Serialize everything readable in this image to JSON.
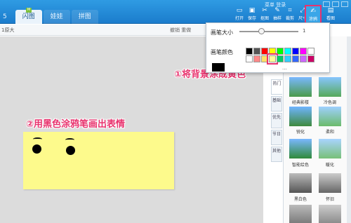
{
  "app": {
    "tabs": [
      {
        "label": "5",
        "active": false
      },
      {
        "label": "闪图",
        "active": true
      },
      {
        "label": "娃娃",
        "active": false
      },
      {
        "label": "拼图",
        "active": false
      }
    ],
    "tab_badge": "M",
    "menu_text": "菜单  登录"
  },
  "toolbar": {
    "items": [
      {
        "label": "打开",
        "icon": "folder-icon"
      },
      {
        "label": "保存",
        "icon": "save-icon"
      },
      {
        "label": "抠图",
        "icon": "scissors-icon"
      },
      {
        "label": "抽样",
        "icon": "eyedropper-icon"
      },
      {
        "label": "裁剪",
        "icon": "crop-icon"
      },
      {
        "label": "尺寸",
        "icon": "resize-icon"
      }
    ],
    "doodle_label": "涂鸦",
    "extra_label": "看图"
  },
  "subbar": {
    "left": "1原大",
    "right": "撤销 重做"
  },
  "doodle_panel": {
    "brush_size_label": "画笔大小",
    "brush_size_value": "1",
    "brush_color_label": "画笔颜色",
    "more_colors": "...",
    "colors": [
      "#000000",
      "#555555",
      "#ff0000",
      "#ffff00",
      "#00ff00",
      "#00ffff",
      "#0000ff",
      "#ff00ff",
      "#ffffff",
      "#ffffff",
      "#ff8888",
      "#ffe066",
      "#ffff99",
      "#00cc66",
      "#33ccff",
      "#3366ff",
      "#cc66ff",
      "#cc0066"
    ],
    "selected_index": 12,
    "accent": "#e8336e"
  },
  "annotations": {
    "step1": "①将背景涂成黄色",
    "step2": "②用黑色涂鸦笔画出表情"
  },
  "sidebar": {
    "vtabs": [
      "热门",
      "基础",
      "优先",
      "节日",
      "其他"
    ],
    "thumb_labels": [
      "经典影楼",
      "冷色调",
      "锐化",
      "柔和",
      "智能绘色",
      "暖化",
      "黑白色",
      "怀旧"
    ]
  }
}
